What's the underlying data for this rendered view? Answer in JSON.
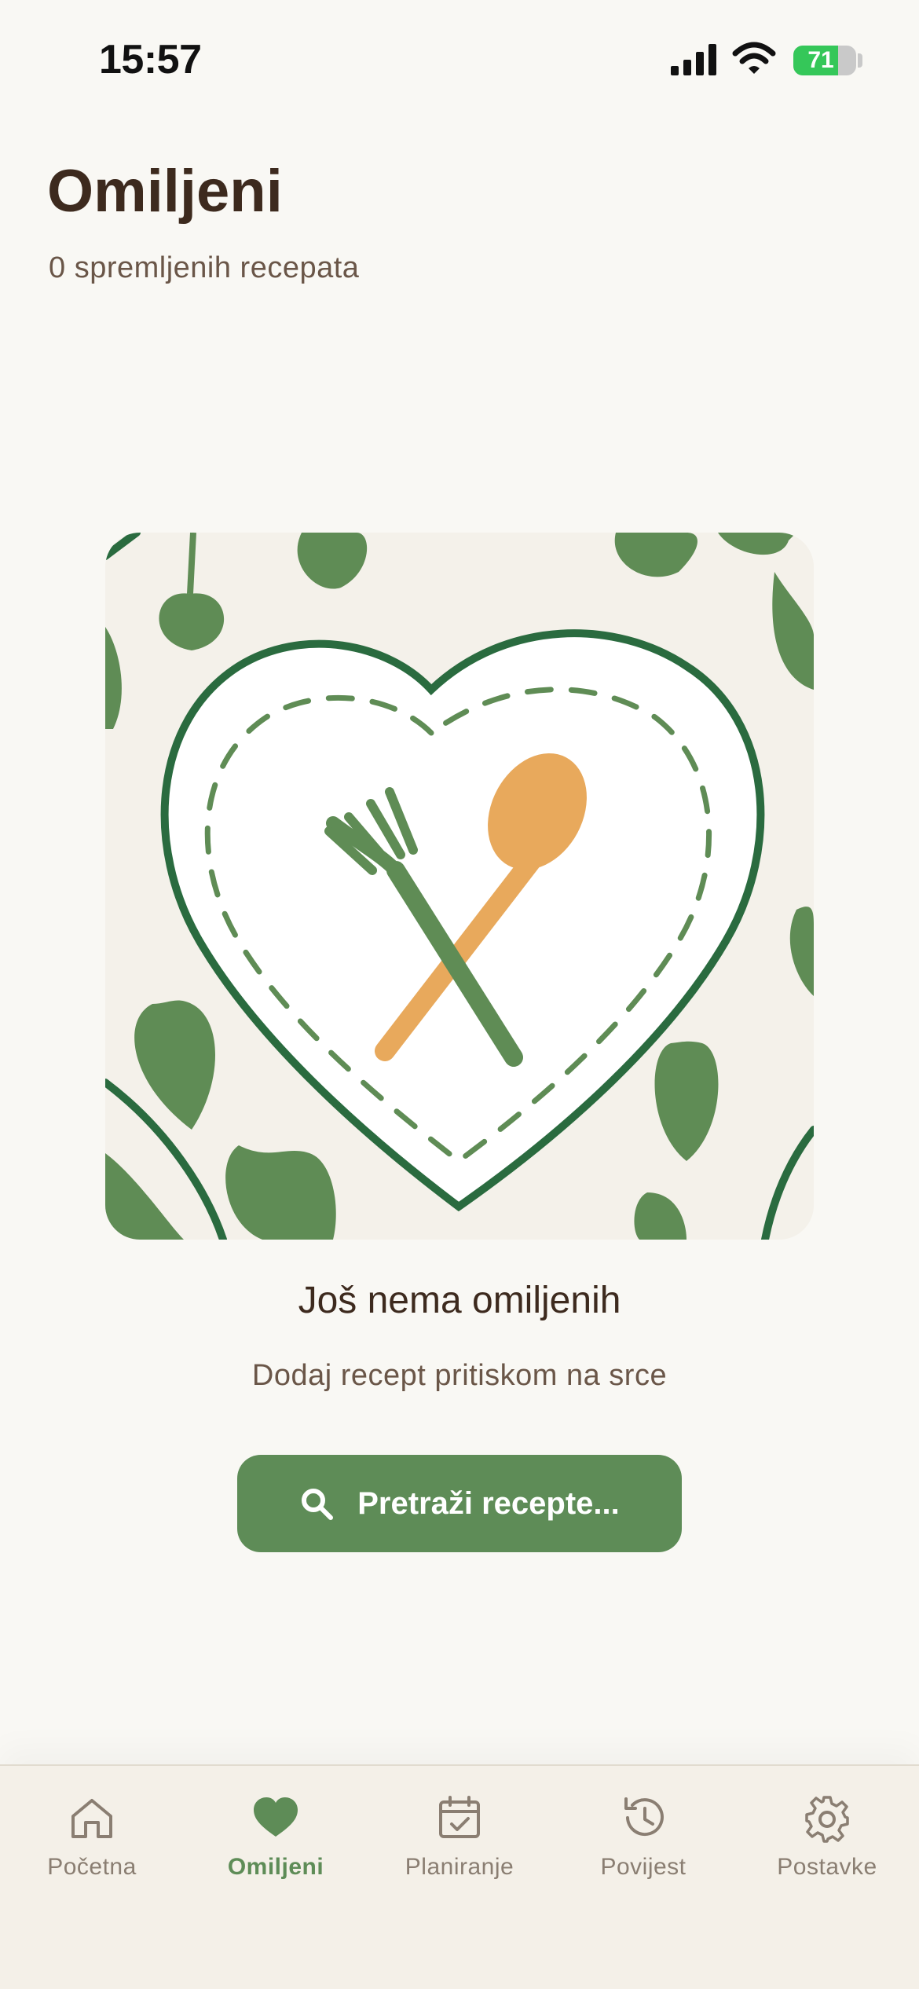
{
  "status_bar": {
    "time": "15:57",
    "battery_level": 71,
    "battery_color": "#35c759"
  },
  "header": {
    "title": "Omiljeni",
    "subtitle": "0 spremljenih recepata"
  },
  "illustration": {
    "icon": "heart-plate-fork-spoon-illustration",
    "colors": {
      "leaf": "#5f8c55",
      "outline": "#2a6b3f",
      "spoon": "#e8a95c",
      "plate": "#ffffff"
    }
  },
  "empty_state": {
    "title": "Još nema omiljenih",
    "hint": "Dodaj recept pritiskom na srce"
  },
  "search_button": {
    "label": "Pretraži recepte...",
    "icon": "search-icon"
  },
  "tab_bar": {
    "active_color": "#5e8c57",
    "inactive_color": "#8a7e72",
    "tabs": [
      {
        "label": "Početna",
        "icon": "home-icon",
        "active": false
      },
      {
        "label": "Omiljeni",
        "icon": "heart-icon",
        "active": true
      },
      {
        "label": "Planiranje",
        "icon": "calendar-check-icon",
        "active": false
      },
      {
        "label": "Povijest",
        "icon": "history-icon",
        "active": false
      },
      {
        "label": "Postavke",
        "icon": "settings-gear-icon",
        "active": false
      }
    ]
  }
}
